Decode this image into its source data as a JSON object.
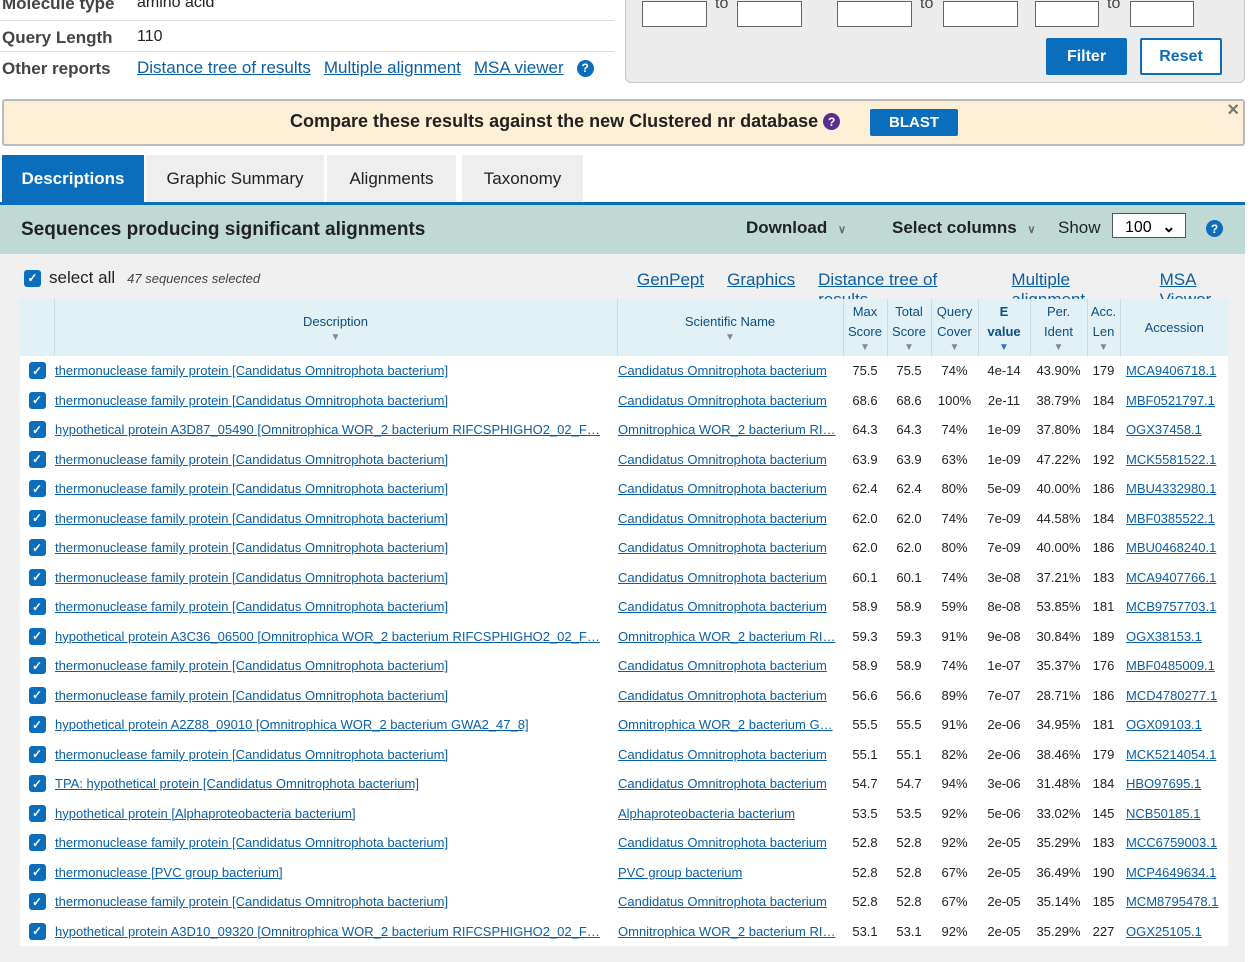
{
  "summary": {
    "molecule_type_label": "Molecule type",
    "molecule_type": "amino acid",
    "query_length_label": "Query Length",
    "query_length": "110",
    "other_reports_label": "Other reports",
    "reports": [
      "Distance tree of results",
      "Multiple alignment",
      "MSA viewer"
    ]
  },
  "filter": {
    "to": "to",
    "filter_label": "Filter",
    "reset_label": "Reset"
  },
  "banner": {
    "text": "Compare these results against the new Clustered nr database",
    "button": "BLAST",
    "close": "×"
  },
  "tabs": [
    "Descriptions",
    "Graphic Summary",
    "Alignments",
    "Taxonomy"
  ],
  "section": {
    "title": "Sequences producing significant alignments",
    "download": "Download",
    "select_columns": "Select columns",
    "show": "Show",
    "show_value": "100"
  },
  "toolbar": {
    "select_all": "select all",
    "selected_count": "47 sequences selected",
    "links": [
      "GenPept",
      "Graphics",
      "Distance tree of results",
      "Multiple alignment",
      "MSA Viewer"
    ]
  },
  "colors": {
    "accent": "#0b6ebd",
    "banner_bg": "#fdf0d6",
    "section_bg": "#bfdad5"
  },
  "table": {
    "headers": {
      "description": "Description",
      "scientific_name": "Scientific Name",
      "max_score": [
        "Max",
        "Score"
      ],
      "total_score": [
        "Total",
        "Score"
      ],
      "query_cover": [
        "Query",
        "Cover"
      ],
      "e_value": [
        "E",
        "value"
      ],
      "per_ident": [
        "Per.",
        "Ident"
      ],
      "acc_len": [
        "Acc.",
        "Len"
      ],
      "accession": "Accession"
    },
    "rows": [
      [
        "thermonuclease family protein [Candidatus Omnitrophota bacterium]",
        "Candidatus Omnitrophota bacterium",
        "75.5",
        "75.5",
        "74%",
        "4e-14",
        "43.90%",
        "179",
        "MCA9406718.1"
      ],
      [
        "thermonuclease family protein [Candidatus Omnitrophota bacterium]",
        "Candidatus Omnitrophota bacterium",
        "68.6",
        "68.6",
        "100%",
        "2e-11",
        "38.79%",
        "184",
        "MBF0521797.1"
      ],
      [
        "hypothetical protein A3D87_05490 [Omnitrophica WOR_2 bacterium RIFCSPHIGHO2_02_F…",
        "Omnitrophica WOR_2 bacterium RI…",
        "64.3",
        "64.3",
        "74%",
        "1e-09",
        "37.80%",
        "184",
        "OGX37458.1"
      ],
      [
        "thermonuclease family protein [Candidatus Omnitrophota bacterium]",
        "Candidatus Omnitrophota bacterium",
        "63.9",
        "63.9",
        "63%",
        "1e-09",
        "47.22%",
        "192",
        "MCK5581522.1"
      ],
      [
        "thermonuclease family protein [Candidatus Omnitrophota bacterium]",
        "Candidatus Omnitrophota bacterium",
        "62.4",
        "62.4",
        "80%",
        "5e-09",
        "40.00%",
        "186",
        "MBU4332980.1"
      ],
      [
        "thermonuclease family protein [Candidatus Omnitrophota bacterium]",
        "Candidatus Omnitrophota bacterium",
        "62.0",
        "62.0",
        "74%",
        "7e-09",
        "44.58%",
        "184",
        "MBF0385522.1"
      ],
      [
        "thermonuclease family protein [Candidatus Omnitrophota bacterium]",
        "Candidatus Omnitrophota bacterium",
        "62.0",
        "62.0",
        "80%",
        "7e-09",
        "40.00%",
        "186",
        "MBU0468240.1"
      ],
      [
        "thermonuclease family protein [Candidatus Omnitrophota bacterium]",
        "Candidatus Omnitrophota bacterium",
        "60.1",
        "60.1",
        "74%",
        "3e-08",
        "37.21%",
        "183",
        "MCA9407766.1"
      ],
      [
        "thermonuclease family protein [Candidatus Omnitrophota bacterium]",
        "Candidatus Omnitrophota bacterium",
        "58.9",
        "58.9",
        "59%",
        "8e-08",
        "53.85%",
        "181",
        "MCB9757703.1"
      ],
      [
        "hypothetical protein A3C36_06500 [Omnitrophica WOR_2 bacterium RIFCSPHIGHO2_02_F…",
        "Omnitrophica WOR_2 bacterium RI…",
        "59.3",
        "59.3",
        "91%",
        "9e-08",
        "30.84%",
        "189",
        "OGX38153.1"
      ],
      [
        "thermonuclease family protein [Candidatus Omnitrophota bacterium]",
        "Candidatus Omnitrophota bacterium",
        "58.9",
        "58.9",
        "74%",
        "1e-07",
        "35.37%",
        "176",
        "MBF0485009.1"
      ],
      [
        "thermonuclease family protein [Candidatus Omnitrophota bacterium]",
        "Candidatus Omnitrophota bacterium",
        "56.6",
        "56.6",
        "89%",
        "7e-07",
        "28.71%",
        "186",
        "MCD4780277.1"
      ],
      [
        "hypothetical protein A2Z88_09010 [Omnitrophica WOR_2 bacterium GWA2_47_8]",
        "Omnitrophica WOR_2 bacterium G…",
        "55.5",
        "55.5",
        "91%",
        "2e-06",
        "34.95%",
        "181",
        "OGX09103.1"
      ],
      [
        "thermonuclease family protein [Candidatus Omnitrophota bacterium]",
        "Candidatus Omnitrophota bacterium",
        "55.1",
        "55.1",
        "82%",
        "2e-06",
        "38.46%",
        "179",
        "MCK5214054.1"
      ],
      [
        "TPA: hypothetical protein [Candidatus Omnitrophota bacterium]",
        "Candidatus Omnitrophota bacterium",
        "54.7",
        "54.7",
        "94%",
        "3e-06",
        "31.48%",
        "184",
        "HBO97695.1"
      ],
      [
        "hypothetical protein [Alphaproteobacteria bacterium]",
        "Alphaproteobacteria bacterium",
        "53.5",
        "53.5",
        "92%",
        "5e-06",
        "33.02%",
        "145",
        "NCB50185.1"
      ],
      [
        "thermonuclease family protein [Candidatus Omnitrophota bacterium]",
        "Candidatus Omnitrophota bacterium",
        "52.8",
        "52.8",
        "92%",
        "2e-05",
        "35.29%",
        "183",
        "MCC6759003.1"
      ],
      [
        "thermonuclease [PVC group bacterium]",
        "PVC group bacterium",
        "52.8",
        "52.8",
        "67%",
        "2e-05",
        "36.49%",
        "190",
        "MCP4649634.1"
      ],
      [
        "thermonuclease family protein [Candidatus Omnitrophota bacterium]",
        "Candidatus Omnitrophota bacterium",
        "52.8",
        "52.8",
        "67%",
        "2e-05",
        "35.14%",
        "185",
        "MCM8795478.1"
      ],
      [
        "hypothetical protein A3D10_09320 [Omnitrophica WOR_2 bacterium RIFCSPHIGHO2_02_F…",
        "Omnitrophica WOR_2 bacterium RI…",
        "53.1",
        "53.1",
        "92%",
        "2e-05",
        "35.29%",
        "227",
        "OGX25105.1"
      ]
    ]
  }
}
